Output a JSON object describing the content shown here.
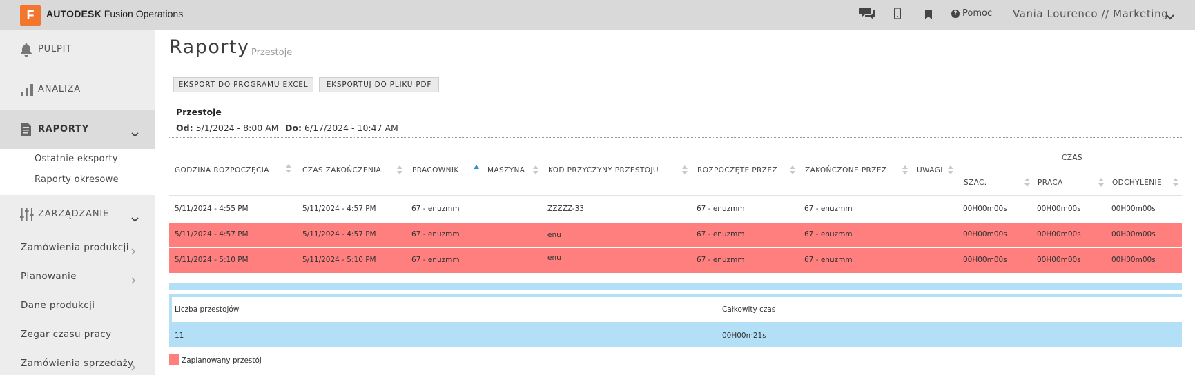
{
  "app": {
    "logo_letter": "F",
    "brand": "AUTODESK",
    "product": "Fusion Operations",
    "help_label": "Pomoc",
    "user_label": "Vania Lourenco // Marketing"
  },
  "sidebar": {
    "items": [
      {
        "label": "PULPIT",
        "icon": "bell-icon"
      },
      {
        "label": "ANALIZA",
        "icon": "bar-chart-icon"
      },
      {
        "label": "RAPORTY",
        "icon": "report-icon"
      },
      {
        "label": "ZARZĄDZANIE",
        "icon": "sliders-icon"
      }
    ],
    "report_subitems": [
      "Ostatnie eksporty",
      "Raporty okresowe"
    ],
    "management_items": [
      "Zamówienia produkcji",
      "Planowanie",
      "Dane produkcji",
      "Zegar czasu pracy",
      "Zamówienia sprzedaży"
    ]
  },
  "page": {
    "title": "Raporty",
    "subtitle": "Przestoje",
    "export_excel": "EKSPORT DO PROGRAMU EXCEL",
    "export_pdf": "EKSPORTUJ DO PLIKU PDF",
    "report_name": "Przestoje",
    "from_label": "Od:",
    "from_value": "5/1/2024 - 8:00 AM",
    "to_label": "Do:",
    "to_value": "6/17/2024 - 10:47 AM"
  },
  "table": {
    "columns": [
      "GODZINA ROZPOCZĘCIA",
      "CZAS ZAKOŃCZENIA",
      "PRACOWNIK",
      "MASZYNA",
      "KOD PRZYCZYNY PRZESTOJU",
      "ROZPOCZĘTE PRZEZ",
      "ZAKOŃCZONE PRZEZ",
      "UWAGI"
    ],
    "group_header": "CZAS",
    "subcolumns": [
      "SZAC.",
      "PRACA",
      "ODCHYLENIE"
    ],
    "rows": [
      {
        "start": "5/11/2024 - 4:55 PM",
        "end": "5/11/2024 - 4:57 PM",
        "worker": "67 - enuzmm",
        "machine": "",
        "reason": "ZZZZZ-33",
        "started_by": "67 - enuzmm",
        "ended_by": "67 - enuzmm",
        "notes": "",
        "est": "00H00m00s",
        "work": "00H00m00s",
        "dev": "00H00m00s",
        "planned": false
      },
      {
        "start": "5/11/2024 - 4:57 PM",
        "end": "5/11/2024 - 4:57 PM",
        "worker": "67 - enuzmm",
        "machine": "",
        "reason": "enu",
        "started_by": "67 - enuzmm",
        "ended_by": "67 - enuzmm",
        "notes": "",
        "est": "00H00m00s",
        "work": "00H00m00s",
        "dev": "00H00m00s",
        "planned": true
      },
      {
        "start": "5/11/2024 - 5:10 PM",
        "end": "5/11/2024 - 5:10 PM",
        "worker": "67 - enuzmm",
        "machine": "",
        "reason": "enu",
        "started_by": "67 - enuzmm",
        "ended_by": "67 - enuzmm",
        "notes": "",
        "est": "00H00m00s",
        "work": "00H00m00s",
        "dev": "00H00m00s",
        "planned": true
      }
    ]
  },
  "summary": {
    "count_label": "Liczba przestojów",
    "total_label": "Całkowity czas",
    "count_value": "11",
    "total_value": "00H00m21s"
  },
  "legend": {
    "planned_label": "Zaplanowany przestój",
    "planned_color": "#ff7f7f"
  }
}
